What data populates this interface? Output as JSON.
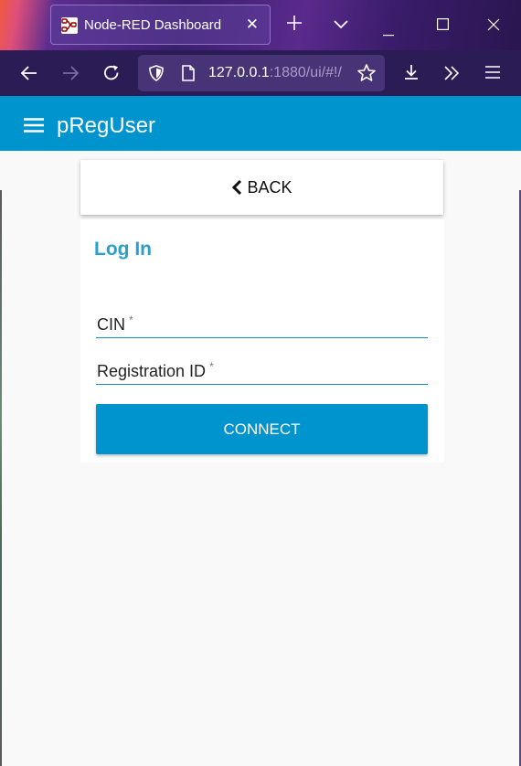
{
  "browser": {
    "tab_title": "Node-RED Dashboard",
    "url_host": "127.0.0.1",
    "url_rest": ":1880/ui/#!/"
  },
  "app": {
    "title": "pRegUser"
  },
  "back_card": {
    "label": "BACK"
  },
  "login": {
    "title": "Log In",
    "fields": [
      {
        "label": "CIN",
        "required_mark": "*"
      },
      {
        "label": "Registration ID",
        "required_mark": "*"
      }
    ],
    "connect_label": "CONNECT"
  },
  "colors": {
    "accent": "#0094ce",
    "title_blue": "#2a9fcb"
  }
}
